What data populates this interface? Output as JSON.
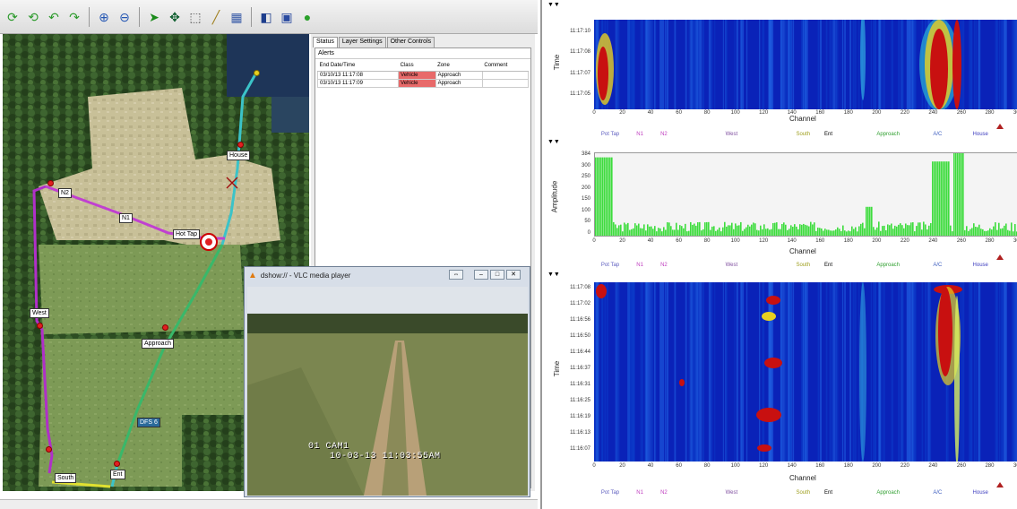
{
  "toolbar": {
    "buttons": [
      {
        "name": "rotate-up-icon",
        "glyph": "⟳",
        "color": "#2c9a2c"
      },
      {
        "name": "rotate-down-icon",
        "glyph": "⟲",
        "color": "#2c9a2c"
      },
      {
        "name": "undo-icon",
        "glyph": "↶",
        "color": "#2c9a2c"
      },
      {
        "name": "redo-icon",
        "glyph": "↷",
        "color": "#2c9a2c"
      },
      {
        "name": "zoom-in-icon",
        "glyph": "⊕",
        "color": "#2456b3"
      },
      {
        "name": "zoom-out-icon",
        "glyph": "⊖",
        "color": "#2456b3"
      },
      {
        "name": "select-arrow-icon",
        "glyph": "➤",
        "color": "#1a8a1a"
      },
      {
        "name": "pan-icon",
        "glyph": "✥",
        "color": "#0e5e2e"
      },
      {
        "name": "zoom-box-icon",
        "glyph": "⬚",
        "color": "#555"
      },
      {
        "name": "measure-icon",
        "glyph": "╱",
        "color": "#a08020"
      },
      {
        "name": "layer-table-icon",
        "glyph": "▦",
        "color": "#3a5ca8"
      },
      {
        "name": "alarm-device-icon",
        "glyph": "◧",
        "color": "#1d3d8c"
      },
      {
        "name": "calendar-icon",
        "glyph": "▣",
        "color": "#2a4aa0"
      },
      {
        "name": "chat-bubble-icon",
        "glyph": "●",
        "color": "#2aa02a"
      }
    ]
  },
  "map": {
    "labels": [
      {
        "id": "house",
        "text": "House"
      },
      {
        "id": "n1",
        "text": "N1"
      },
      {
        "id": "n2",
        "text": "N2"
      },
      {
        "id": "hot-tap",
        "text": "Hot Tap"
      },
      {
        "id": "west",
        "text": "West"
      },
      {
        "id": "approach",
        "text": "Approach"
      },
      {
        "id": "south",
        "text": "South"
      },
      {
        "id": "ent",
        "text": "Ent"
      },
      {
        "id": "dfs",
        "text": "DFS 6"
      }
    ]
  },
  "status_panel": {
    "tabs": [
      "Status",
      "Layer Settings",
      "Other Controls"
    ],
    "alerts_label": "Alerts",
    "columns": [
      "End Date/Time",
      "Class",
      "Zone",
      "Comment"
    ],
    "rows": [
      {
        "end": "03/10/13 11:17:08",
        "class": "Vehicle",
        "zone": "Approach",
        "comment": ""
      },
      {
        "end": "03/10/13 11:17:09",
        "class": "Vehicle",
        "zone": "Approach",
        "comment": ""
      }
    ]
  },
  "vlc": {
    "title": "dshow:// - VLC media player",
    "osd_cam": "01 CAM1",
    "osd_time": "10-03-13 11:03:55AM"
  },
  "top_plot": {
    "ylabel": "Time",
    "yticks": [
      "11:17:10",
      "11:17:08",
      "11:17:07",
      "11:17:05"
    ],
    "xlabel": "Channel"
  },
  "mid_plot": {
    "ylabel": "Amplitude",
    "yticks": [
      "384",
      "300",
      "250",
      "200",
      "150",
      "100",
      "50",
      "0"
    ],
    "xlabel": "Channel"
  },
  "bottom_plot": {
    "ylabel": "Time",
    "yticks": [
      "11:17:08",
      "11:17:02",
      "11:16:56",
      "11:16:50",
      "11:16:44",
      "11:16:37",
      "11:16:31",
      "11:16:25",
      "11:16:19",
      "11:16:13",
      "11:16:07"
    ],
    "xlabel": "Channel"
  },
  "xticks": [
    "0",
    "20",
    "40",
    "60",
    "80",
    "100",
    "120",
    "140",
    "160",
    "180",
    "200",
    "220",
    "240",
    "260",
    "280",
    "300"
  ],
  "zones": [
    {
      "text": "Pot Tap",
      "color": "#6060c0",
      "ch": 5
    },
    {
      "text": "N1",
      "color": "#c040c0",
      "ch": 30
    },
    {
      "text": "N2",
      "color": "#c040c0",
      "ch": 47
    },
    {
      "text": "West",
      "color": "#8050a0",
      "ch": 93
    },
    {
      "text": "South",
      "color": "#a0a020",
      "ch": 143
    },
    {
      "text": "Ent",
      "color": "#000000",
      "ch": 163
    },
    {
      "text": "Approach",
      "color": "#30a030",
      "ch": 200
    },
    {
      "text": "A/C",
      "color": "#4060c0",
      "ch": 240
    },
    {
      "text": "House",
      "color": "#4040c0",
      "ch": 268
    }
  ],
  "colors": {
    "spectro_bg": "#0a22b8",
    "amp_bar": "#3ddc3d",
    "hot": "#c81010"
  }
}
